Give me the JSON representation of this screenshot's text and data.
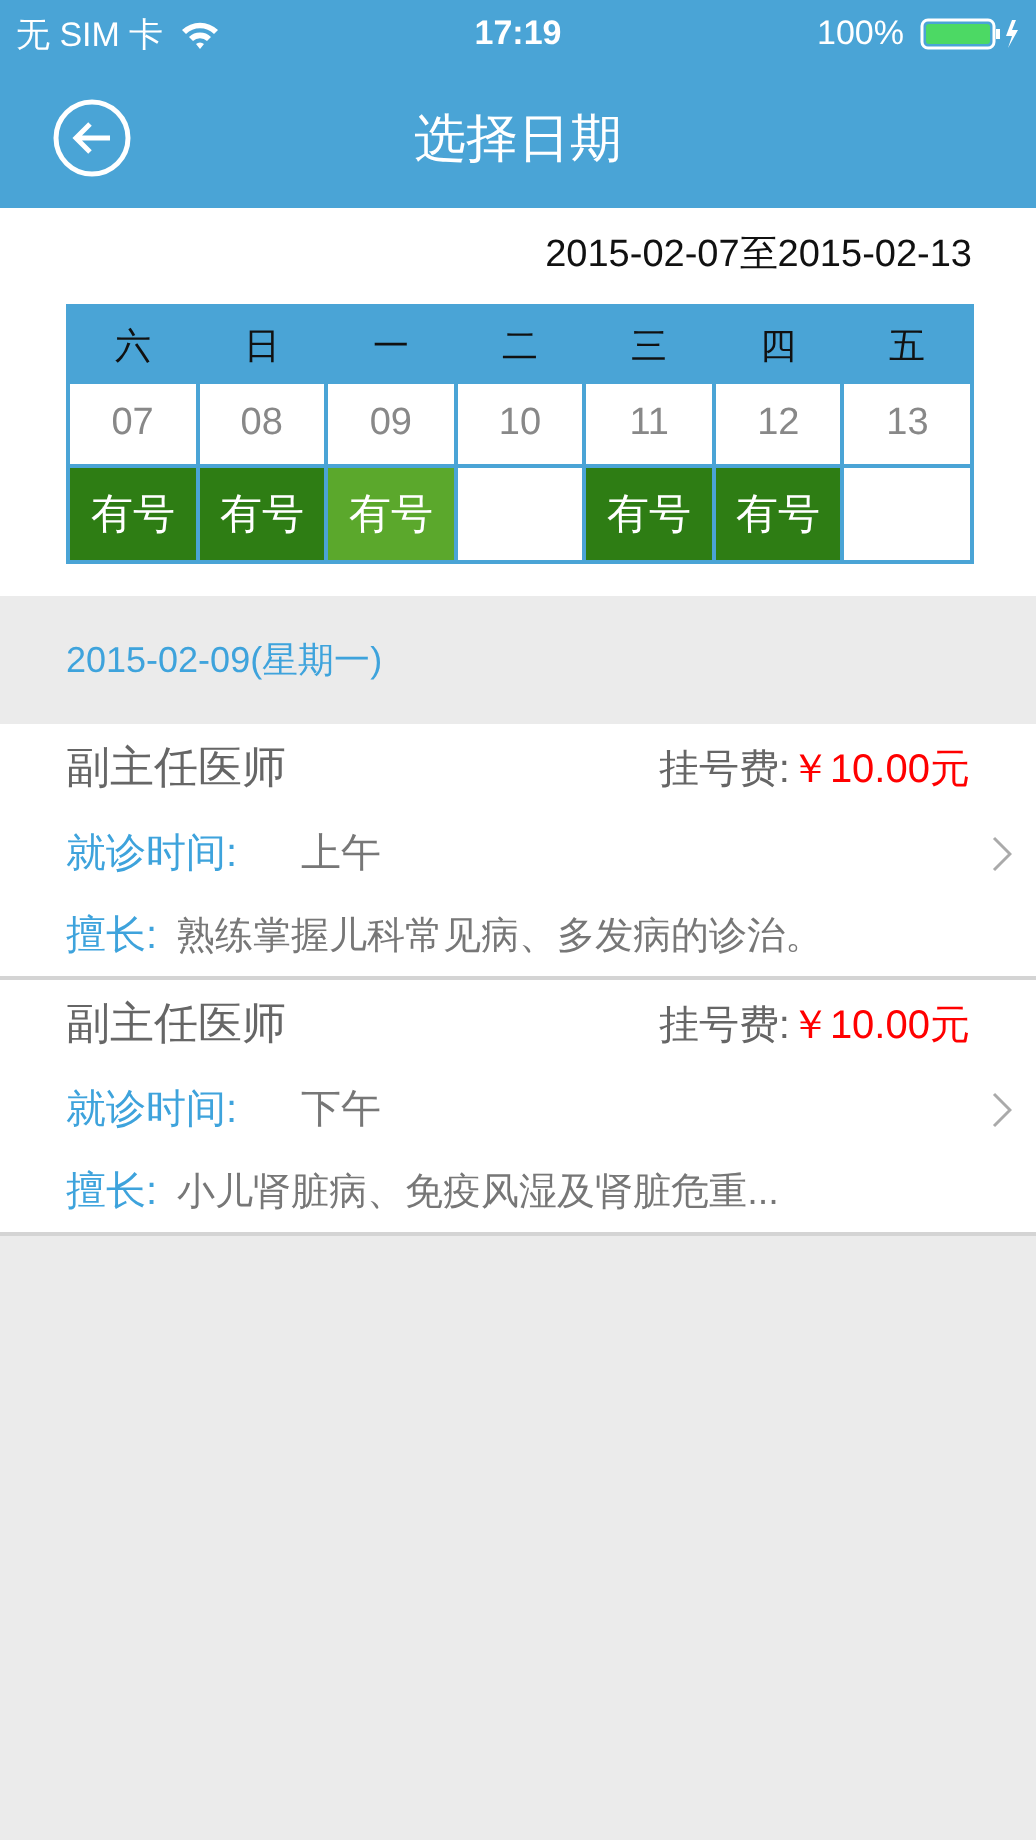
{
  "status_bar": {
    "carrier": "无 SIM 卡",
    "time": "17:19",
    "battery": "100%"
  },
  "nav": {
    "title": "选择日期"
  },
  "range": "2015-02-07至2015-02-13",
  "days": [
    {
      "weekday": "六",
      "date": "07",
      "status": "有号",
      "selected": false
    },
    {
      "weekday": "日",
      "date": "08",
      "status": "有号",
      "selected": false
    },
    {
      "weekday": "一",
      "date": "09",
      "status": "有号",
      "selected": true
    },
    {
      "weekday": "二",
      "date": "10",
      "selected": false
    },
    {
      "weekday": "三",
      "date": "11",
      "status": "有号",
      "selected": false
    },
    {
      "weekday": "四",
      "date": "12",
      "status": "有号",
      "selected": false
    },
    {
      "weekday": "五",
      "date": "13",
      "selected": false
    }
  ],
  "section_date": "2015-02-09(星期一)",
  "doctors": [
    {
      "title": "副主任医师",
      "fee_label": "挂号费:",
      "fee": "￥10.00元",
      "time_label": "就诊时间:",
      "time": "上午",
      "specialty_label": "擅长:",
      "specialty": "熟练掌握儿科常见病、多发病的诊治。"
    },
    {
      "title": "副主任医师",
      "fee_label": "挂号费:",
      "fee": "￥10.00元",
      "time_label": "就诊时间:",
      "time": "下午",
      "specialty_label": "擅长:",
      "specialty": "小儿肾脏病、免疫风湿及肾脏危重..."
    }
  ]
}
